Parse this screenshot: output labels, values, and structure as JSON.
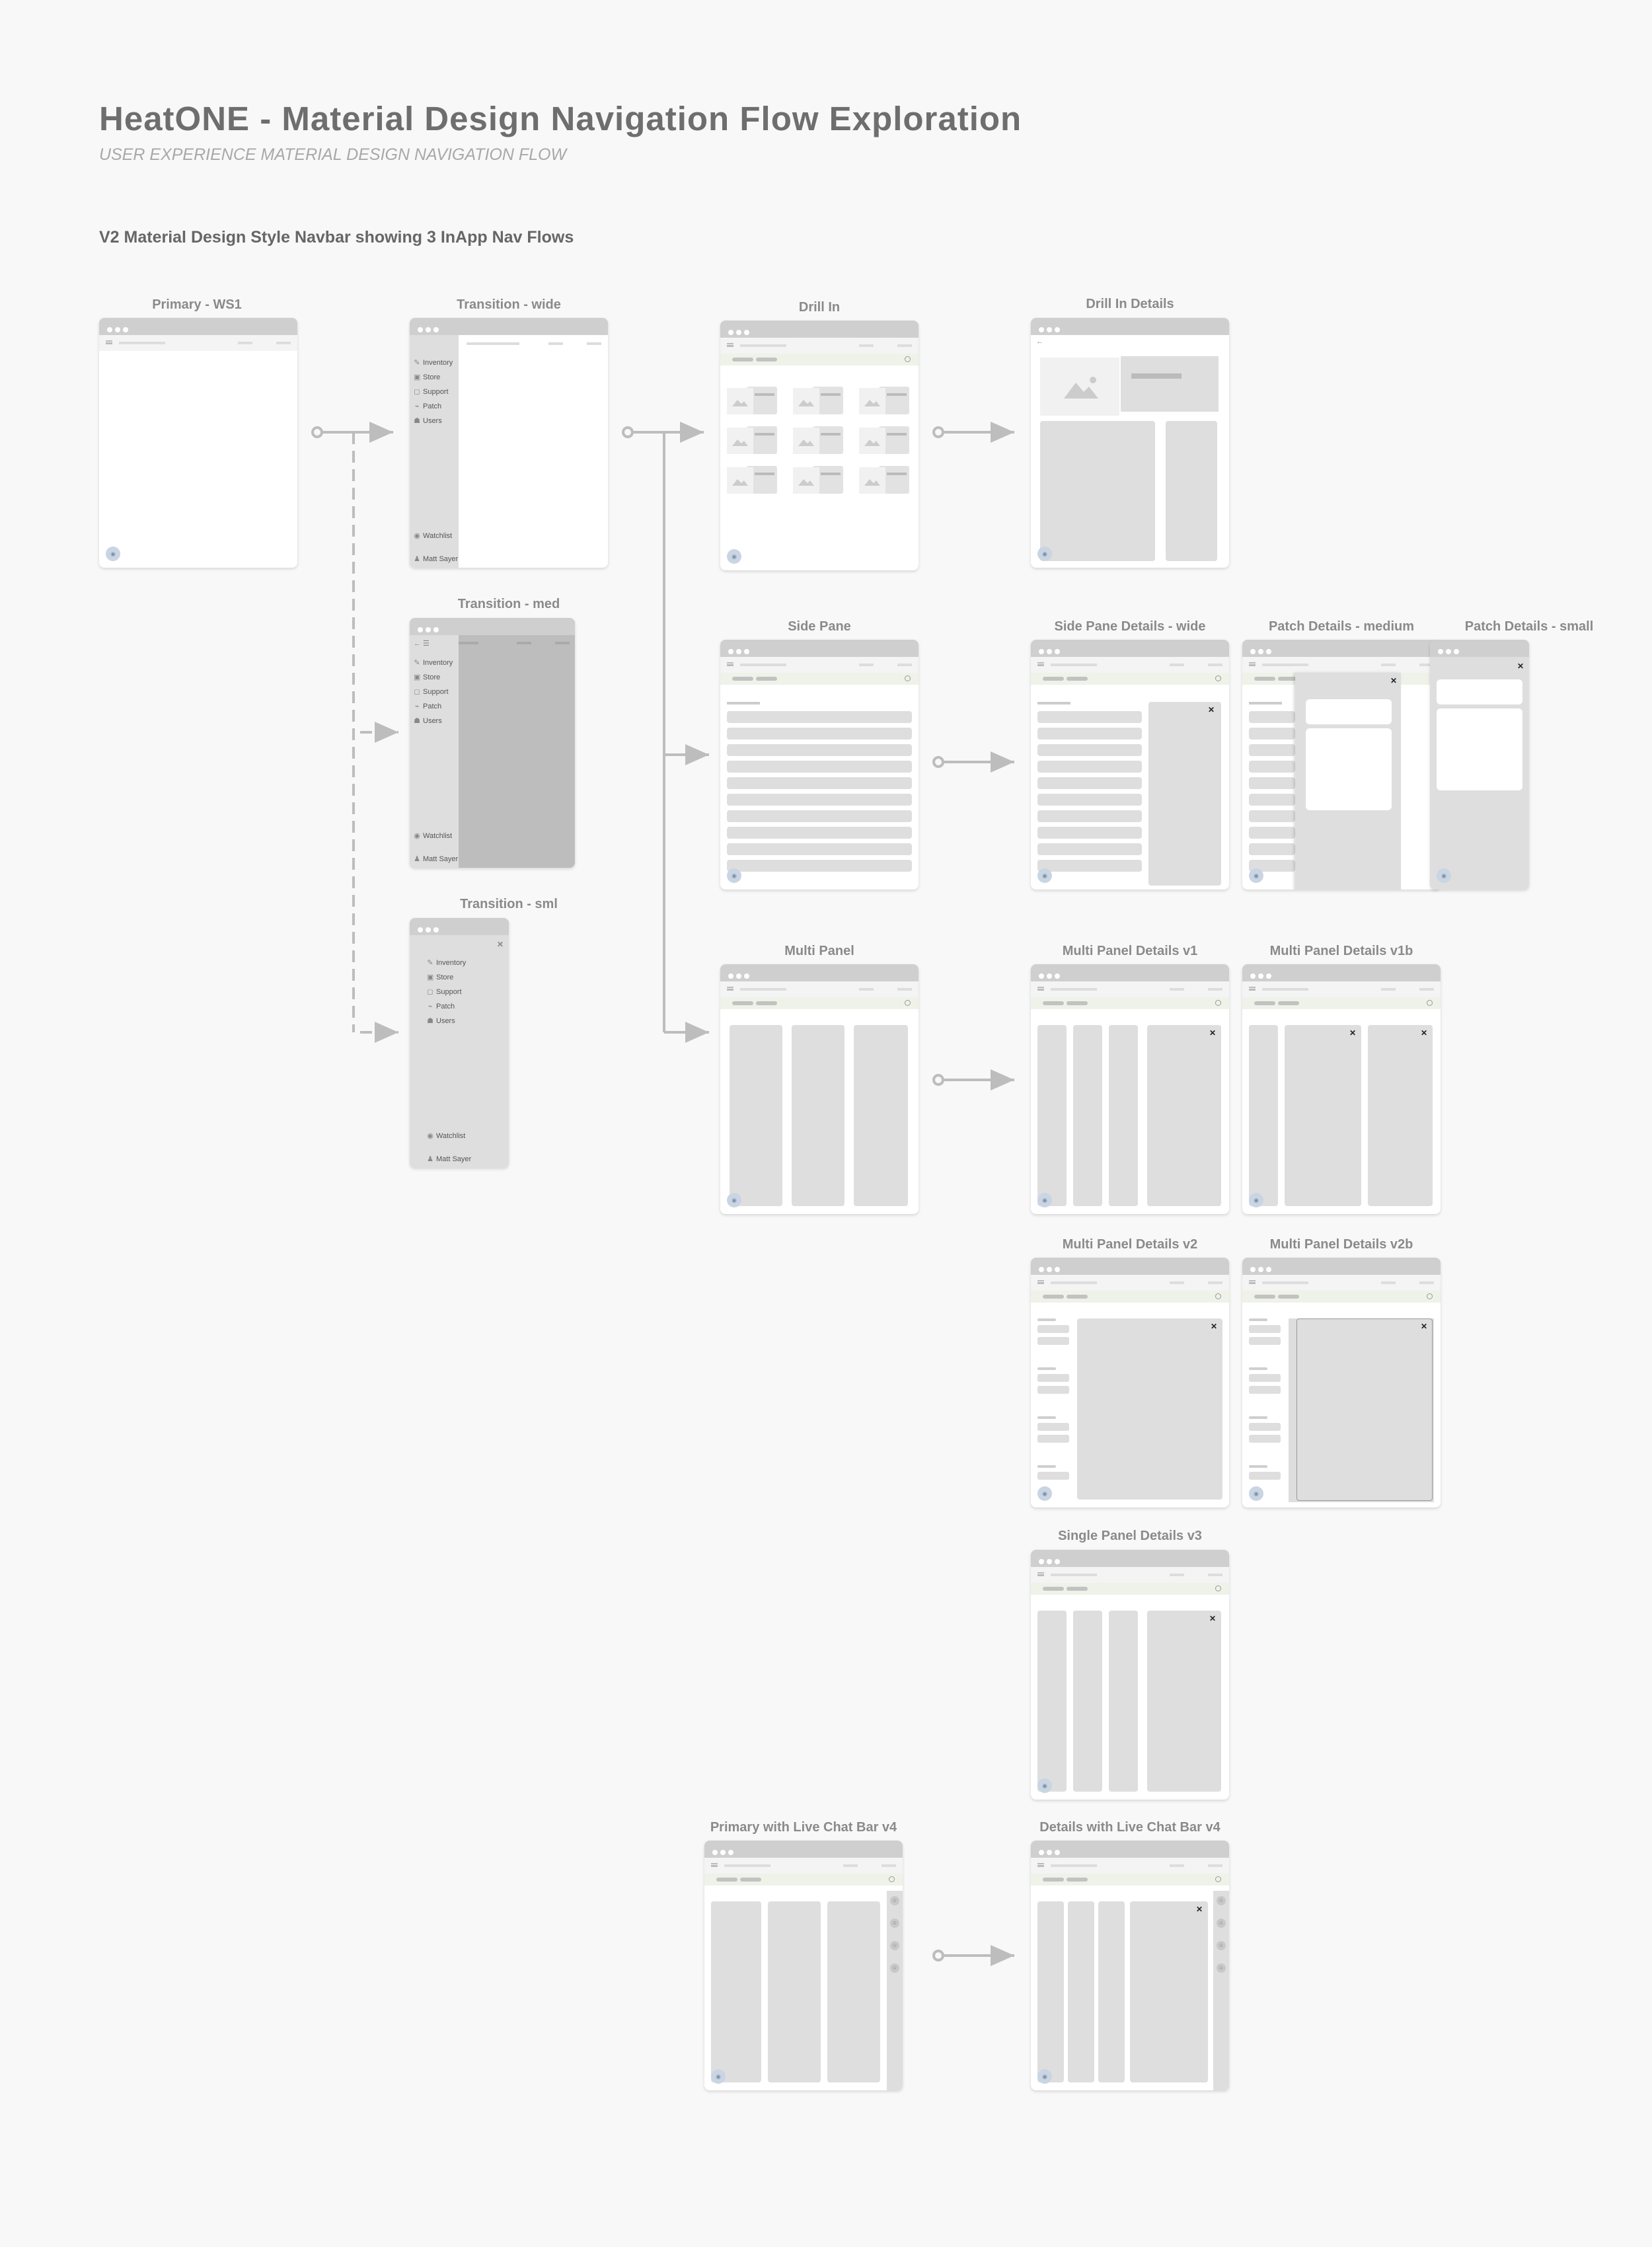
{
  "page": {
    "title": "HeatONE - Material Design Navigation Flow Exploration",
    "subtitle": "USER EXPERIENCE MATERIAL DESIGN NAVIGATION FLOW",
    "section": "V2 Material Design Style Navbar showing 3 InApp Nav Flows"
  },
  "frames": {
    "primary_ws1": "Primary - WS1",
    "transition_wide": "Transition - wide",
    "transition_med": "Transition - med",
    "transition_sml": "Transition - sml",
    "drill_in": "Drill In",
    "drill_in_details": "Drill In Details",
    "side_pane": "Side Pane",
    "side_pane_details_wide": "Side Pane Details - wide",
    "patch_details_medium": "Patch Details - medium",
    "patch_details_small": "Patch Details - small",
    "multi_panel": "Multi Panel",
    "multi_panel_details_v1": "Multi Panel Details v1",
    "multi_panel_details_v1b": "Multi Panel Details v1b",
    "multi_panel_details_v2": "Multi Panel Details v2",
    "multi_panel_details_v2b": "Multi Panel Details v2b",
    "single_panel_details_v3": "Single Panel Details v3",
    "primary_live_chat_v4": "Primary with Live Chat Bar v4",
    "details_live_chat_v4": "Details with Live Chat Bar v4"
  },
  "nav": {
    "items": [
      "Inventory",
      "Store",
      "Support",
      "Patch",
      "Users"
    ],
    "watchlist": "Watchlist",
    "user": "Matt Sayer"
  },
  "icons": {
    "close": "close-icon",
    "menu": "hamburger-icon",
    "search": "search-icon",
    "fab": "eye-icon",
    "image": "image-placeholder-icon"
  },
  "colors": {
    "background": "#f8f8f8",
    "title_bar": "#cfcfcf",
    "panel": "#dedede",
    "connector": "#bdbdbd",
    "search_bar": "#eef2e8",
    "fab": "#c9d5e3"
  }
}
